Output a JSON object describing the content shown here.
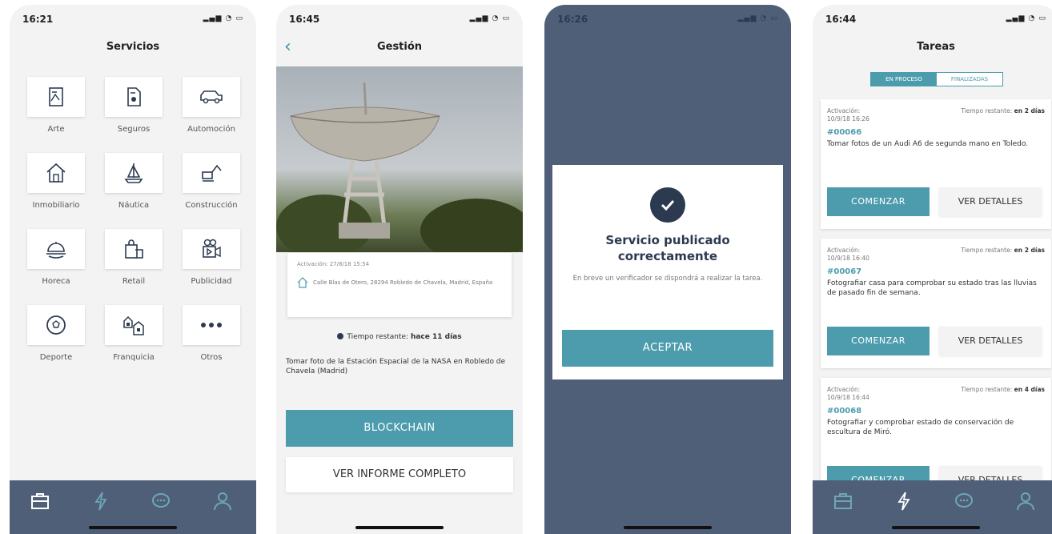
{
  "colors": {
    "navy": "#4f5f78",
    "teal": "#4d9cad",
    "dark": "#2c3a50"
  },
  "screen1": {
    "status_time": "16:21",
    "title": "Servicios",
    "services": [
      {
        "label": "Arte",
        "icon": "art-icon"
      },
      {
        "label": "Seguros",
        "icon": "insurance-icon"
      },
      {
        "label": "Automoción",
        "icon": "car-icon"
      },
      {
        "label": "Inmobiliario",
        "icon": "house-icon"
      },
      {
        "label": "Náutica",
        "icon": "sailboat-icon"
      },
      {
        "label": "Construcción",
        "icon": "excavator-icon"
      },
      {
        "label": "Horeca",
        "icon": "cloche-icon"
      },
      {
        "label": "Retail",
        "icon": "shopping-bag-icon"
      },
      {
        "label": "Publicidad",
        "icon": "video-camera-icon"
      },
      {
        "label": "Deporte",
        "icon": "soccer-ball-icon"
      },
      {
        "label": "Franquicia",
        "icon": "shops-icon"
      },
      {
        "label": "Otros",
        "icon": "more-dots-icon"
      }
    ]
  },
  "screen2": {
    "status_time": "16:45",
    "title": "Gestión",
    "activation": "Activación: 27/8/18 15:54",
    "address": "Calle Blas de Otero, 28294 Robledo de Chavela, Madrid, España",
    "remaining_label": "Tiempo restante:",
    "remaining_value": "hace 11 días",
    "description": "Tomar foto de la Estación Espacial de la NASA en Robledo de Chavela (Madrid)",
    "blockchain_button": "BLOCKCHAIN",
    "report_button": "VER INFORME COMPLETO"
  },
  "screen3": {
    "status_time": "16:26",
    "title_line1": "Servicio publicado",
    "title_line2": "correctamente",
    "text": "En breve un verificador se dispondrá a realizar la tarea.",
    "accept_button": "ACEPTAR"
  },
  "screen4": {
    "status_time": "16:44",
    "title": "Tareas",
    "tab_active": "EN PROCESO",
    "tab_inactive": "FINALIZADAS",
    "tasks": [
      {
        "activation_label": "Activación:",
        "activation_date": "10/9/18 16:26",
        "remaining_label": "Tiempo restante:",
        "remaining_value": "en 2 días",
        "code": "#00066",
        "description": "Tomar fotos de un Audi A6 de segunda mano en Toledo.",
        "start": "COMENZAR",
        "details": "VER DETALLES"
      },
      {
        "activation_label": "Activación:",
        "activation_date": "10/9/18 16:40",
        "remaining_label": "Tiempo restante:",
        "remaining_value": "en 2 días",
        "code": "#00067",
        "description": "Fotografiar casa para comprobar su estado tras las lluvias de pasado fin de semana.",
        "start": "COMENZAR",
        "details": "VER DETALLES"
      },
      {
        "activation_label": "Activación:",
        "activation_date": "10/9/18 16:44",
        "remaining_label": "Tiempo restante:",
        "remaining_value": "en 4 días",
        "code": "#00068",
        "description": "Fotografiar y comprobar estado de conservación de escultura de Miró.",
        "start": "COMENZAR",
        "details": "VER DETALLES"
      }
    ]
  },
  "tabbar_icons": [
    "briefcase-icon",
    "lightning-icon",
    "chat-icon",
    "user-icon"
  ]
}
